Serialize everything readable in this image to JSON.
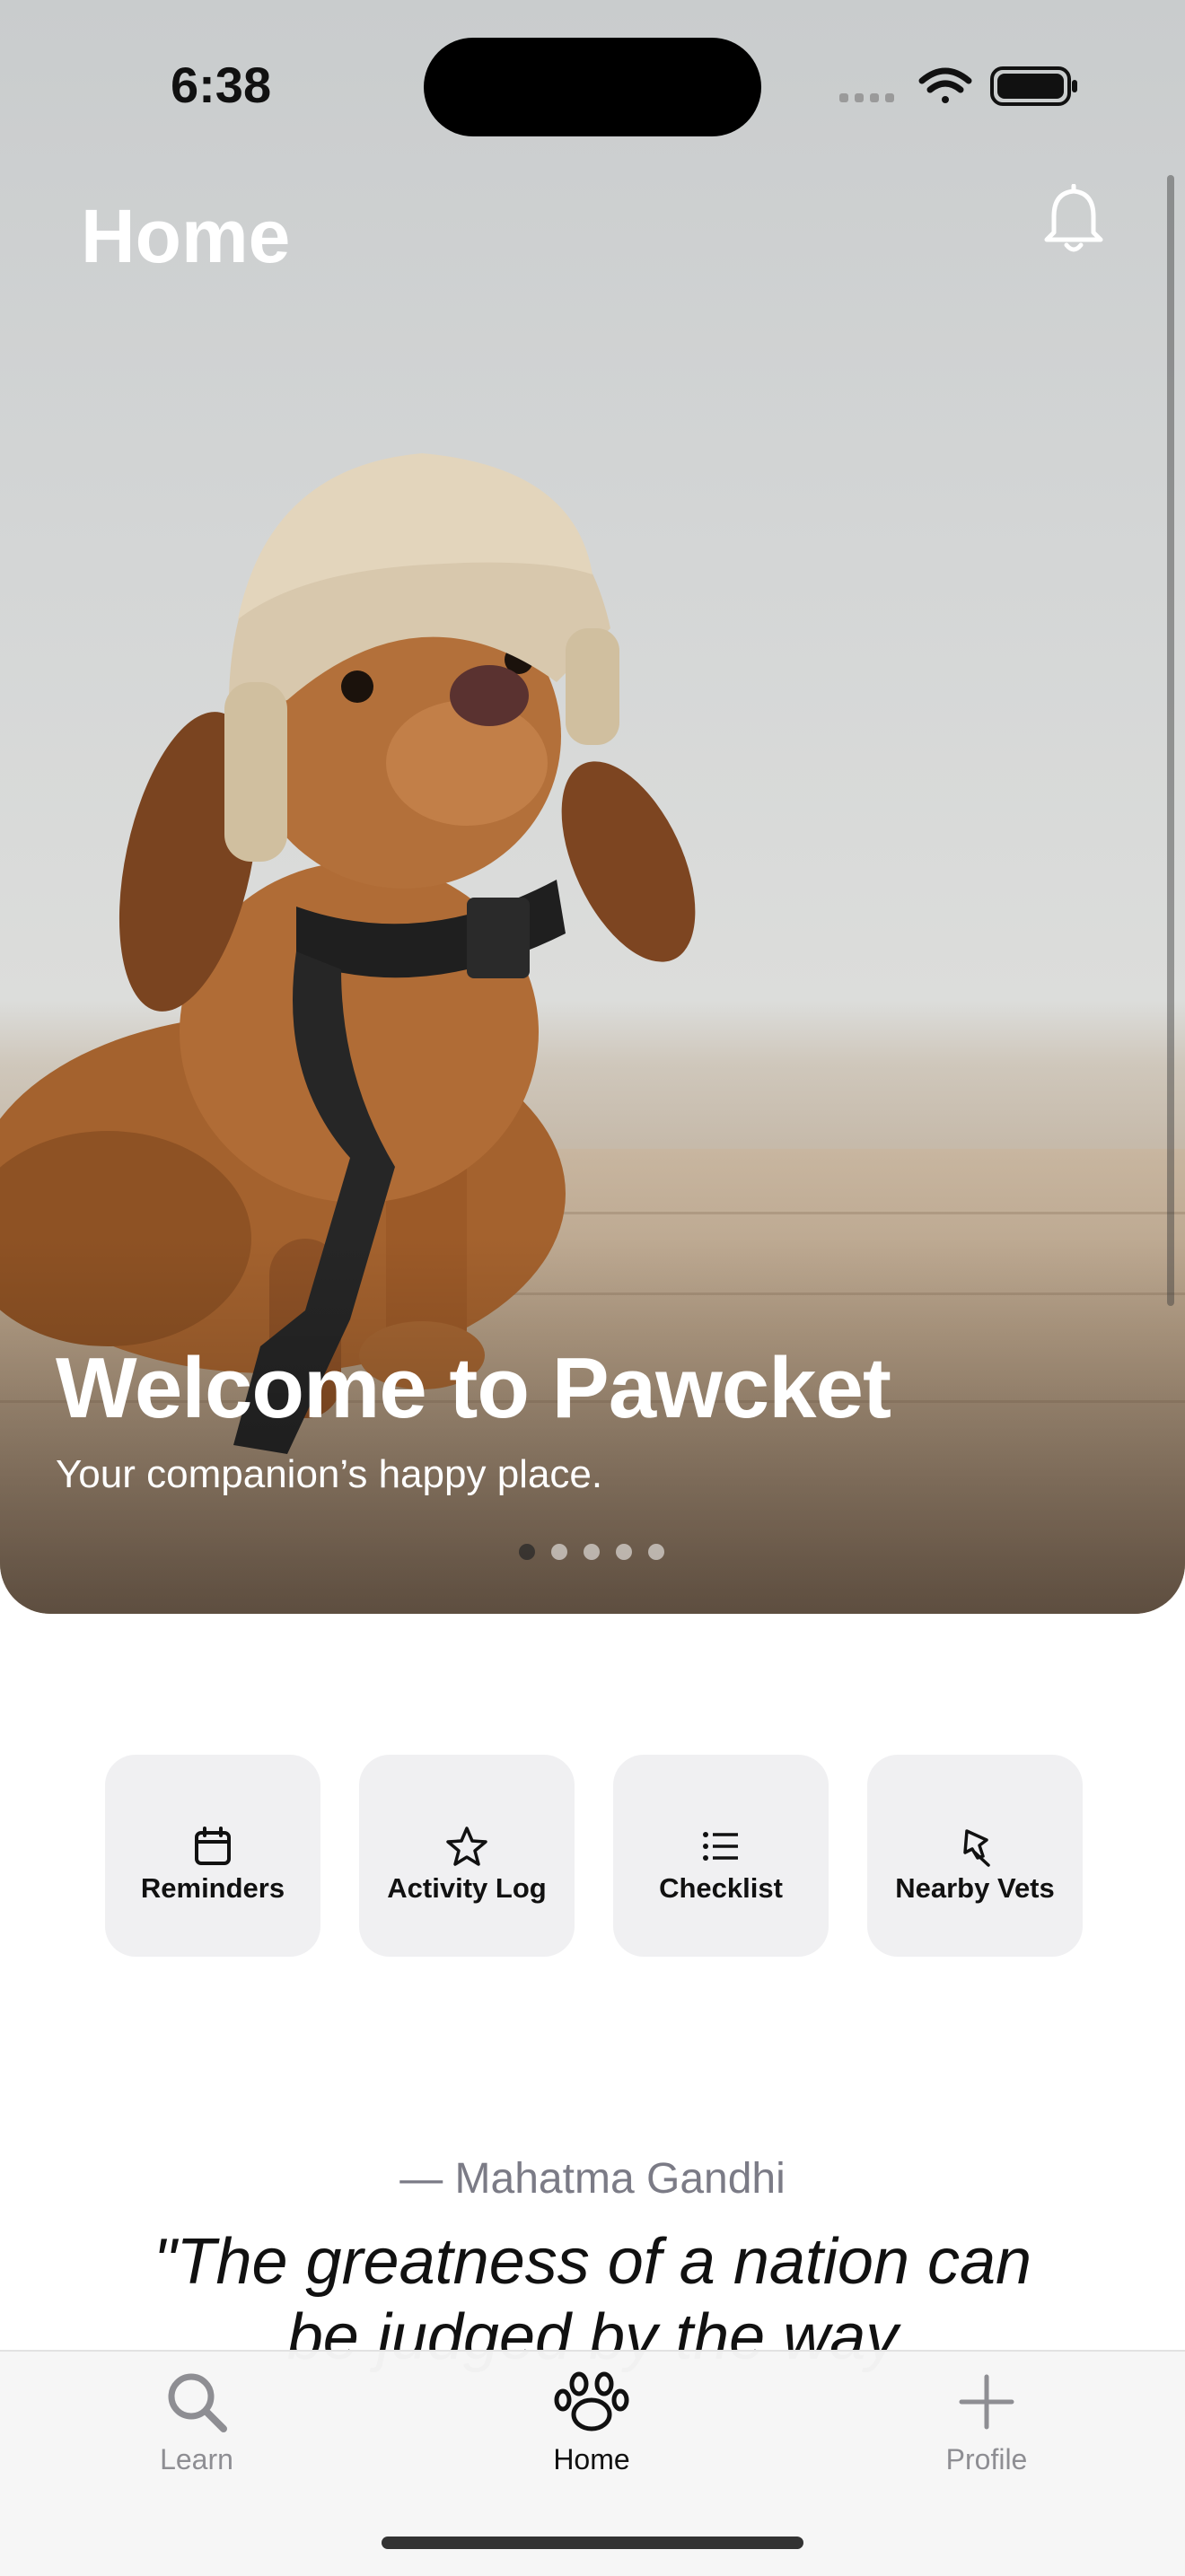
{
  "status_bar": {
    "time": "6:38"
  },
  "nav": {
    "title": "Home",
    "bell_icon": "bell-icon"
  },
  "hero": {
    "title": "Welcome to Pawcket",
    "subtitle": "Your companion’s happy place.",
    "carousel_total": 5,
    "carousel_active": 1
  },
  "actions": [
    {
      "label": "Reminders",
      "icon": "calendar-icon"
    },
    {
      "label": "Activity Log",
      "icon": "star-icon"
    },
    {
      "label": "Checklist",
      "icon": "list-icon"
    },
    {
      "label": "Nearby Vets",
      "icon": "pin-icon"
    }
  ],
  "quote": {
    "author": "— Mahatma Gandhi",
    "text": "\"The greatness of a nation can be judged by the way"
  },
  "tabs": [
    {
      "label": "Learn",
      "icon": "search-icon",
      "active": false
    },
    {
      "label": "Home",
      "icon": "paw-icon",
      "active": true
    },
    {
      "label": "Profile",
      "icon": "plus-icon",
      "active": false
    }
  ],
  "colors": {
    "tab_active": "#111111",
    "tab_inactive": "#8e8e93",
    "action_bg": "#f0f0f2"
  }
}
